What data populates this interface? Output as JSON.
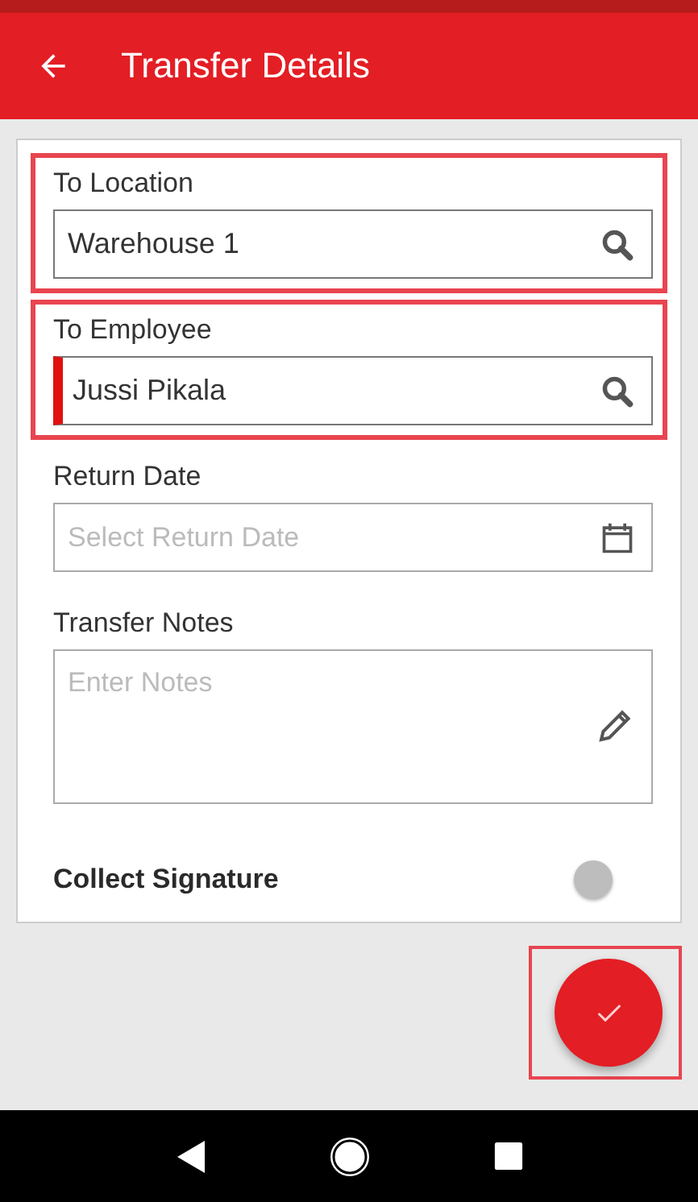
{
  "app_bar": {
    "title": "Transfer Details"
  },
  "fields": [
    {
      "kind": "search",
      "label": "To Location",
      "value": "Warehouse 1",
      "highlighted": true,
      "focused": false
    },
    {
      "kind": "search",
      "label": "To Employee",
      "value": "Jussi Pikala",
      "highlighted": true,
      "focused": true
    },
    {
      "kind": "date",
      "label": "Return Date",
      "placeholder": "Select Return Date",
      "highlighted": false,
      "focused": false
    },
    {
      "kind": "notes",
      "label": "Transfer Notes",
      "placeholder": "Enter Notes",
      "highlighted": false,
      "focused": false
    }
  ],
  "signature": {
    "label": "Collect Signature",
    "checked": false
  },
  "confirm_button": {
    "highlighted": true
  }
}
